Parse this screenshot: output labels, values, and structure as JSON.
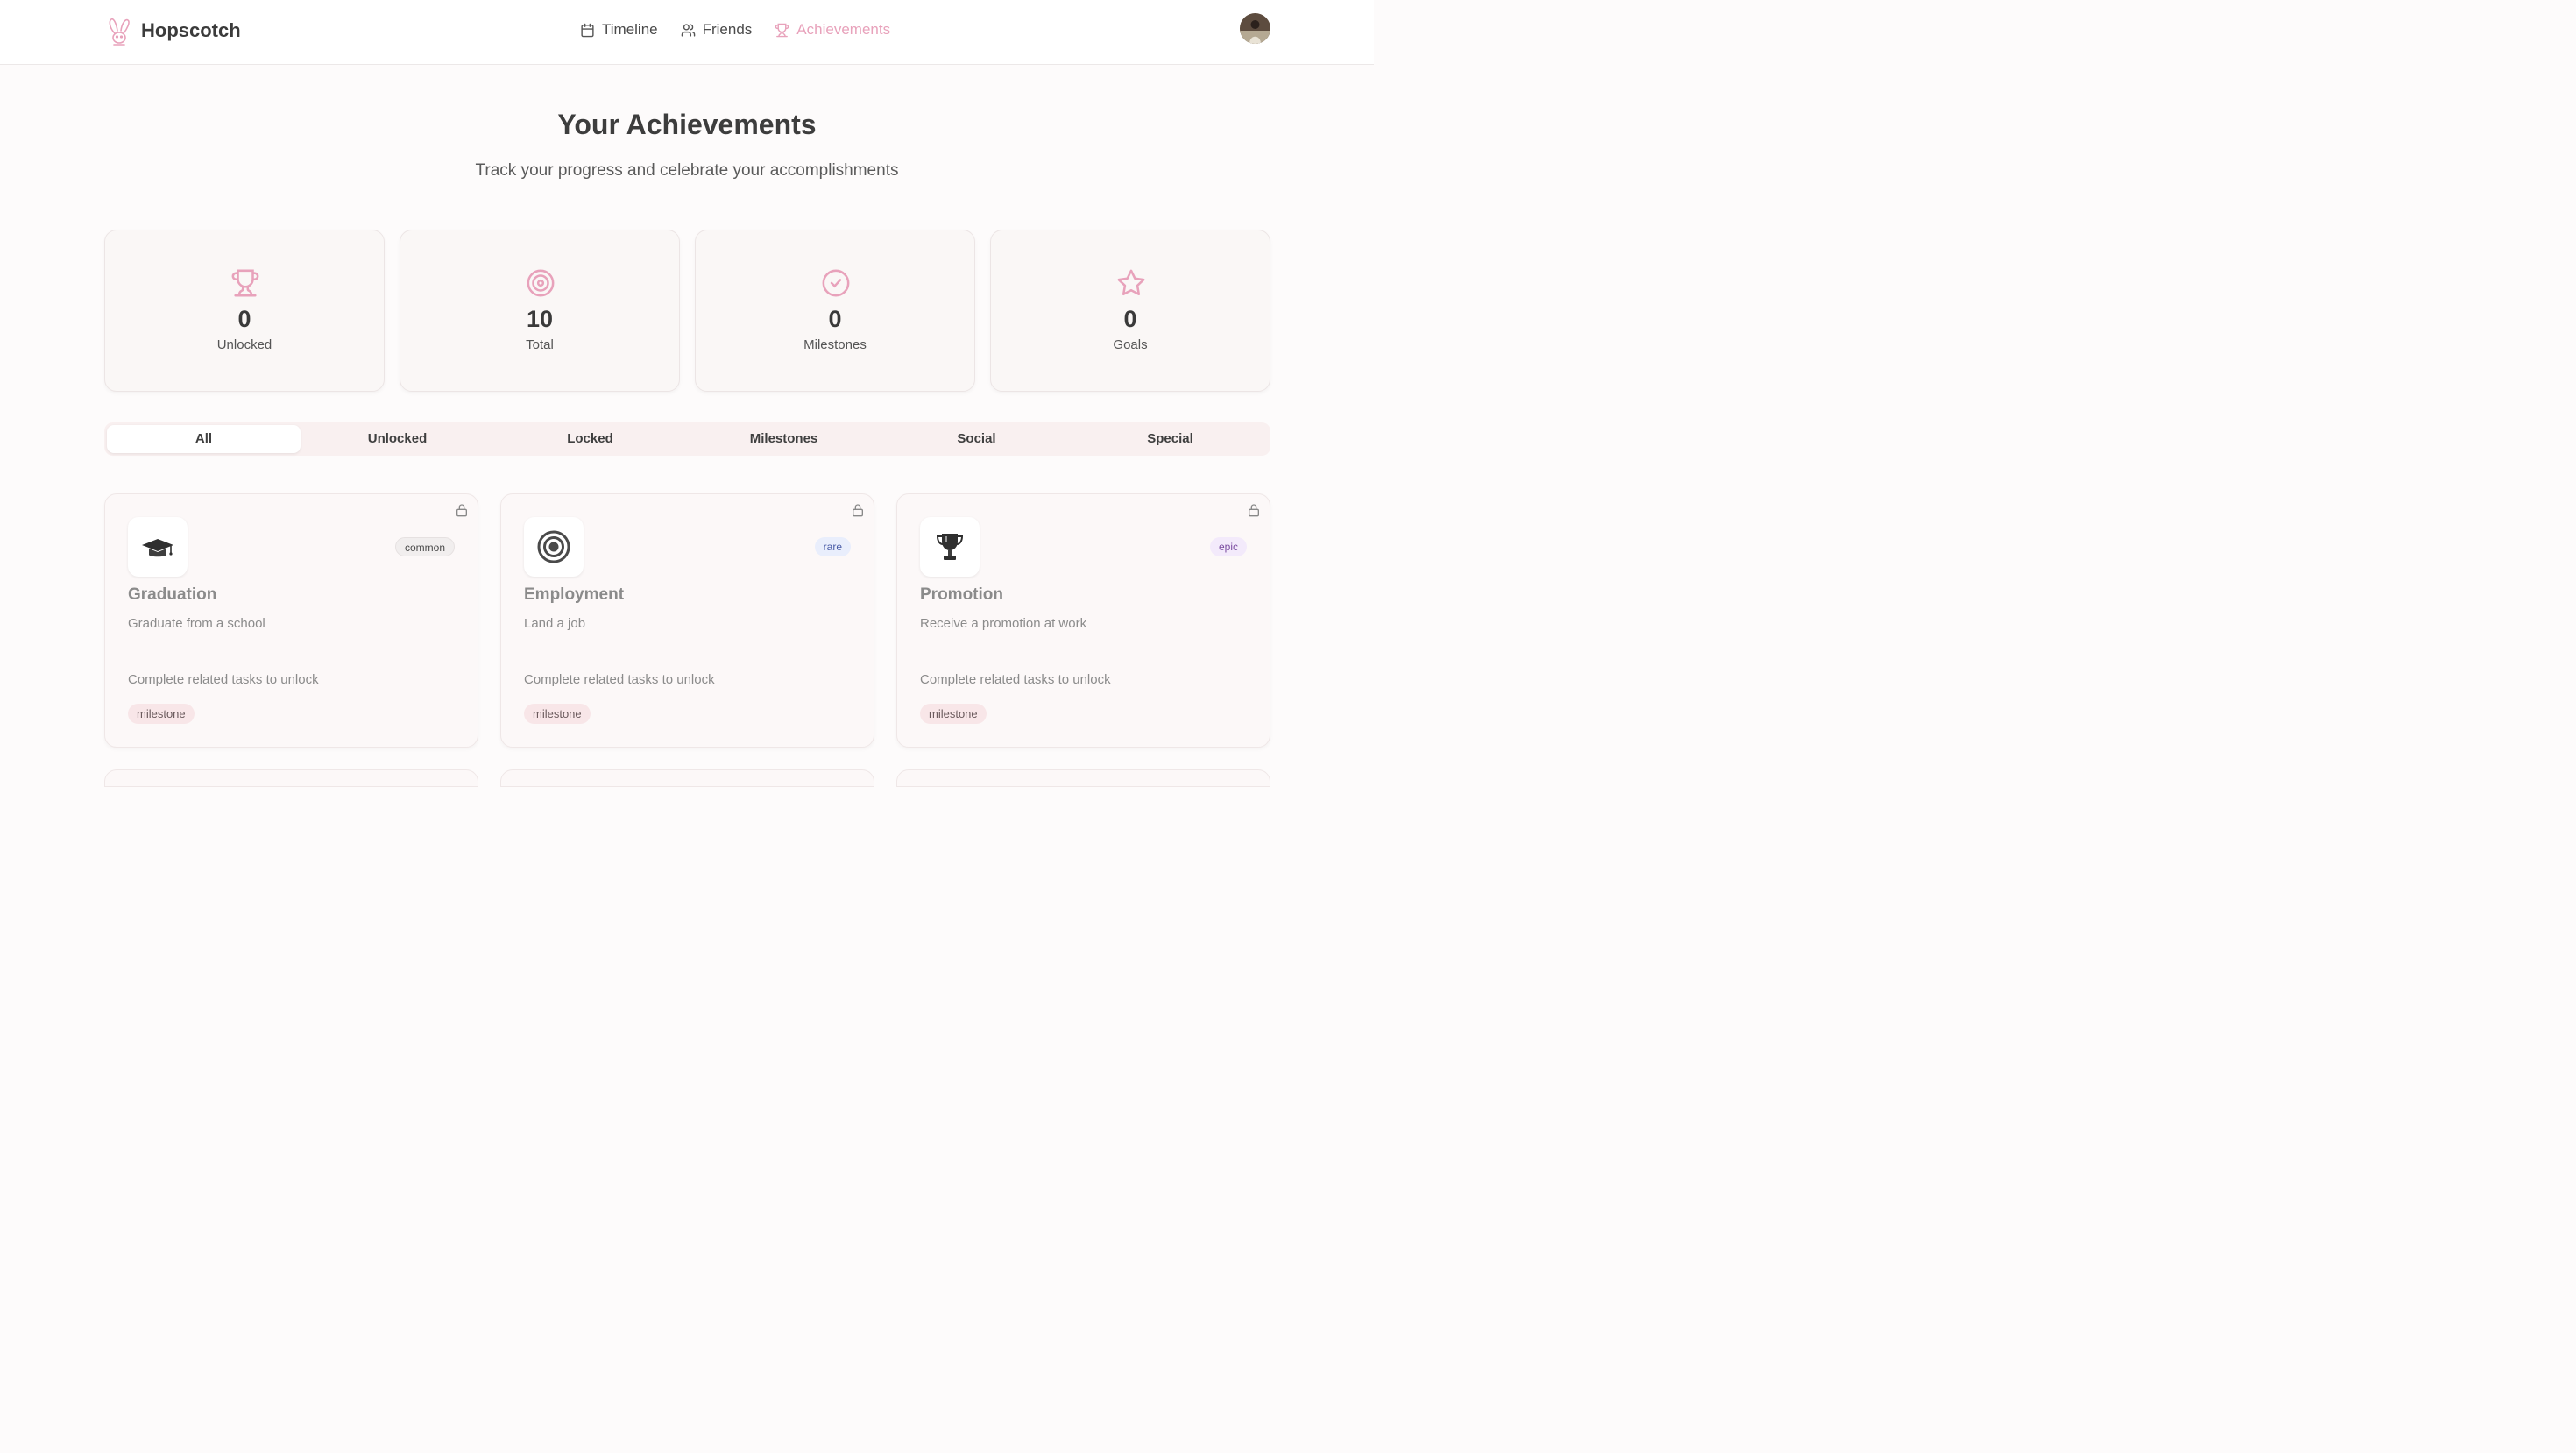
{
  "header": {
    "brand": "Hopscotch",
    "nav": [
      {
        "label": "Timeline",
        "icon": "calendar-icon"
      },
      {
        "label": "Friends",
        "icon": "users-icon"
      },
      {
        "label": "Achievements",
        "icon": "trophy-icon",
        "active": true
      }
    ],
    "accent_color": "#e8a2bb"
  },
  "hero": {
    "title": "Your Achievements",
    "subtitle": "Track your progress and celebrate your accomplishments"
  },
  "stats": [
    {
      "value": "0",
      "label": "Unlocked",
      "icon": "trophy-icon"
    },
    {
      "value": "10",
      "label": "Total",
      "icon": "target-icon"
    },
    {
      "value": "0",
      "label": "Milestones",
      "icon": "check-circle-icon"
    },
    {
      "value": "0",
      "label": "Goals",
      "icon": "star-icon"
    }
  ],
  "tabs": [
    {
      "label": "All",
      "active": true
    },
    {
      "label": "Unlocked"
    },
    {
      "label": "Locked"
    },
    {
      "label": "Milestones"
    },
    {
      "label": "Social"
    },
    {
      "label": "Special"
    }
  ],
  "achievements": [
    {
      "name": "Graduation",
      "description": "Graduate from a school",
      "rarity": "common",
      "hint": "Complete related tasks to unlock",
      "category": "milestone",
      "icon": "graduation-cap-icon"
    },
    {
      "name": "Employment",
      "description": "Land a job",
      "rarity": "rare",
      "hint": "Complete related tasks to unlock",
      "category": "milestone",
      "icon": "bullseye-icon"
    },
    {
      "name": "Promotion",
      "description": "Receive a promotion at work",
      "rarity": "epic",
      "hint": "Complete related tasks to unlock",
      "category": "milestone",
      "icon": "trophy-icon"
    }
  ]
}
